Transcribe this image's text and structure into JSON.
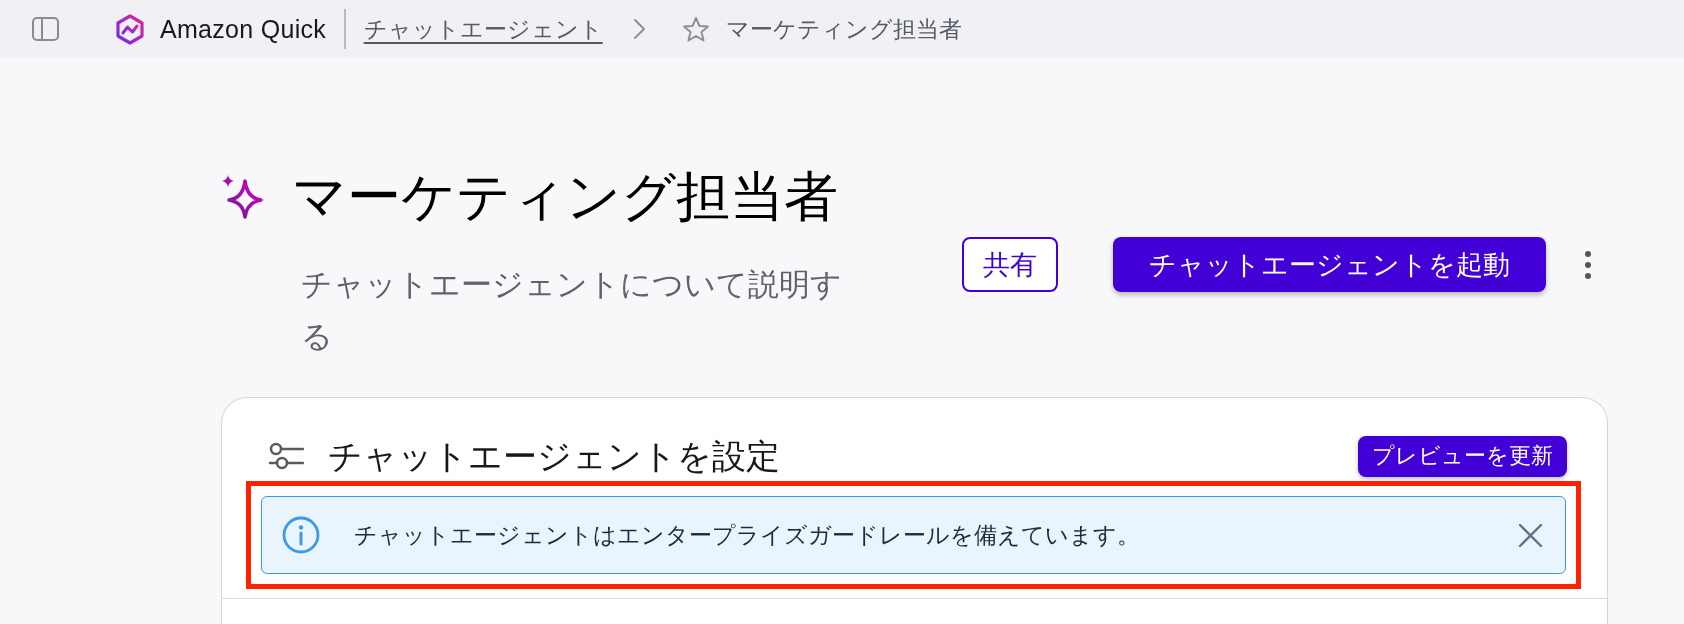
{
  "top_bar": {
    "brand": "Amazon Quick",
    "breadcrumbs": [
      {
        "kind": "link",
        "label": "チャットエージェント"
      },
      {
        "kind": "current",
        "label": "マーケティング担当者",
        "starred": false
      }
    ]
  },
  "header": {
    "title": "マーケティング担当者",
    "description": "チャットエージェントについて説明する",
    "actions": [
      {
        "kind": "secondary",
        "label": "共有"
      },
      {
        "kind": "primary",
        "label": "チャットエージェントを起動"
      }
    ]
  },
  "config_card": {
    "title": "チャットエージェントを設定",
    "preview_button": "プレビューを更新",
    "alert": {
      "kind": "info",
      "message": "チャットエージェントはエンタープライズガードレールを備えています。",
      "dismissible": true,
      "highlighted": true
    }
  }
}
